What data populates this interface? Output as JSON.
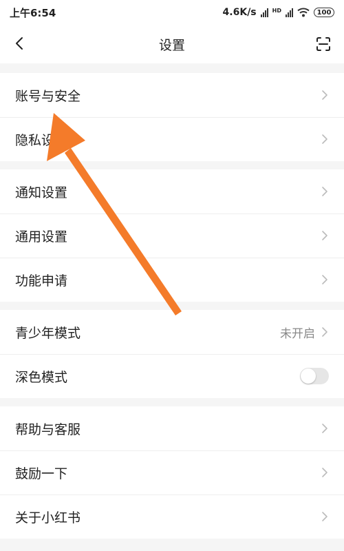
{
  "status_bar": {
    "time": "上午6:54",
    "speed": "4.6K/s",
    "hd_label": "HD",
    "battery": "100"
  },
  "header": {
    "title": "设置"
  },
  "groups": [
    {
      "items": [
        {
          "label": "账号与安全"
        },
        {
          "label": "隐私设置"
        }
      ]
    },
    {
      "items": [
        {
          "label": "通知设置"
        },
        {
          "label": "通用设置"
        },
        {
          "label": "功能申请"
        }
      ]
    },
    {
      "items": [
        {
          "label": "青少年模式",
          "value": "未开启"
        },
        {
          "label": "深色模式",
          "toggle_on": false
        }
      ]
    },
    {
      "items": [
        {
          "label": "帮助与客服"
        },
        {
          "label": "鼓励一下"
        },
        {
          "label": "关于小红书"
        }
      ]
    }
  ],
  "colors": {
    "annotation_arrow": "#f47b2a"
  }
}
